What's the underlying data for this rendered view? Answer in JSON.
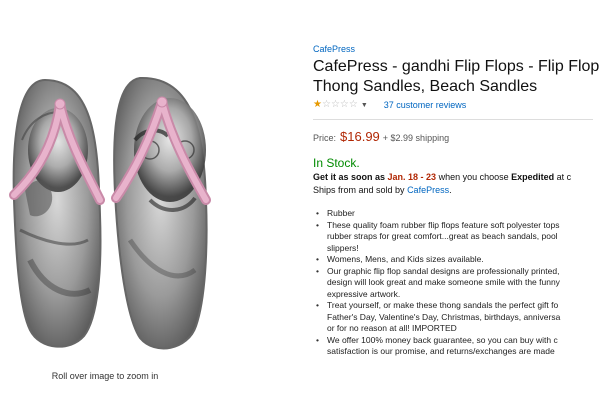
{
  "image": {
    "zoom_hint": "Roll over image to zoom in",
    "strap_color": "#e8b3cc"
  },
  "product": {
    "brand": "CafePress",
    "title_line1": "CafePress - gandhi Flip Flops - Flip Flop",
    "title_line2": "Thong Sandles, Beach Sandles",
    "rating_stars": 1,
    "rating_max": 5,
    "reviews": "37 customer reviews",
    "price_label": "Price:",
    "price": "$16.99",
    "shipping": "+ $2.99 shipping",
    "stock": "In Stock.",
    "delivery_prefix": "Get it as soon as ",
    "delivery_date": "Jan. 18 - 23",
    "delivery_mid": " when you choose ",
    "delivery_option": "Expedited",
    "delivery_suffix": " at c",
    "ships_prefix": "Ships from and sold by ",
    "ships_seller": "CafePress",
    "ships_suffix": ".",
    "bullets": [
      [
        "Rubber"
      ],
      [
        "These quality foam rubber flip flops feature soft polyester tops",
        "rubber straps for great comfort...great as beach sandals, pool",
        "slippers!"
      ],
      [
        "Womens, Mens, and Kids sizes available."
      ],
      [
        "Our graphic flip flop sandal designs are professionally printed,",
        "design will look great and make someone smile with the funny",
        "expressive artwork."
      ],
      [
        "Treat yourself, or make these thong sandals the perfect gift fo",
        "Father's Day, Valentine's Day, Christmas, birthdays, anniversa",
        "or for no reason at all! IMPORTED"
      ],
      [
        "We offer 100% money back guarantee, so you can buy with c",
        "satisfaction is our promise, and returns/exchanges are made"
      ]
    ]
  },
  "colors": {
    "link": "#0066c0",
    "price": "#b12704",
    "in_stock": "#008a00",
    "star": "#e69900"
  }
}
